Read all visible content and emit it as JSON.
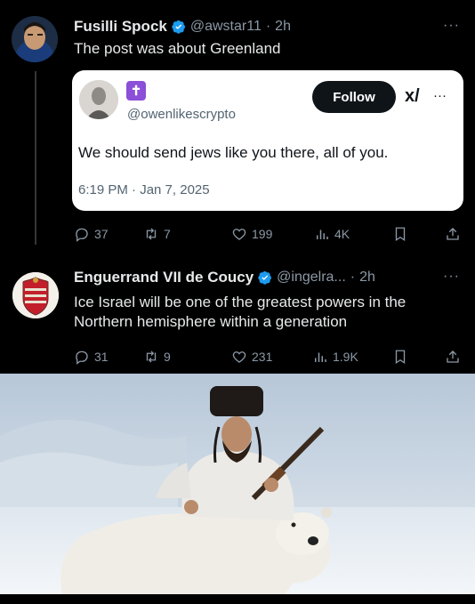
{
  "tweet1": {
    "name": "Fusilli Spock",
    "handle": "@awstar11",
    "time": "2h",
    "text": "The post was about Greenland",
    "more": "···",
    "quote": {
      "badge_glyph": "✝",
      "handle": "@owenlikescrypto",
      "follow_label": "Follow",
      "text": "We should send jews like you there, all of you.",
      "timestamp": "6:19 PM · Jan 7, 2025",
      "more": "···",
      "grok_glyph": "x/"
    },
    "actions": {
      "replies": "37",
      "reposts": "7",
      "likes": "199",
      "views": "4K"
    }
  },
  "tweet2": {
    "name": "Enguerrand VII de Coucy",
    "handle": "@ingelra...",
    "time": "2h",
    "text": "Ice Israel will be one of the greatest powers in the Northern hemisphere within a generation",
    "more": "···",
    "actions": {
      "replies": "31",
      "reposts": "9",
      "likes": "231",
      "views": "1.9K"
    }
  },
  "icons": {
    "reply": "reply-icon",
    "repost": "repost-icon",
    "like": "heart-icon",
    "views": "views-icon",
    "bookmark": "bookmark-icon",
    "share": "share-icon",
    "verified": "verified-badge-icon"
  },
  "colors": {
    "background": "#000000",
    "text": "#e7e9ea",
    "muted": "#8b98a5",
    "verified": "#1d9bf0",
    "badge_purple": "#8b4fd8"
  }
}
